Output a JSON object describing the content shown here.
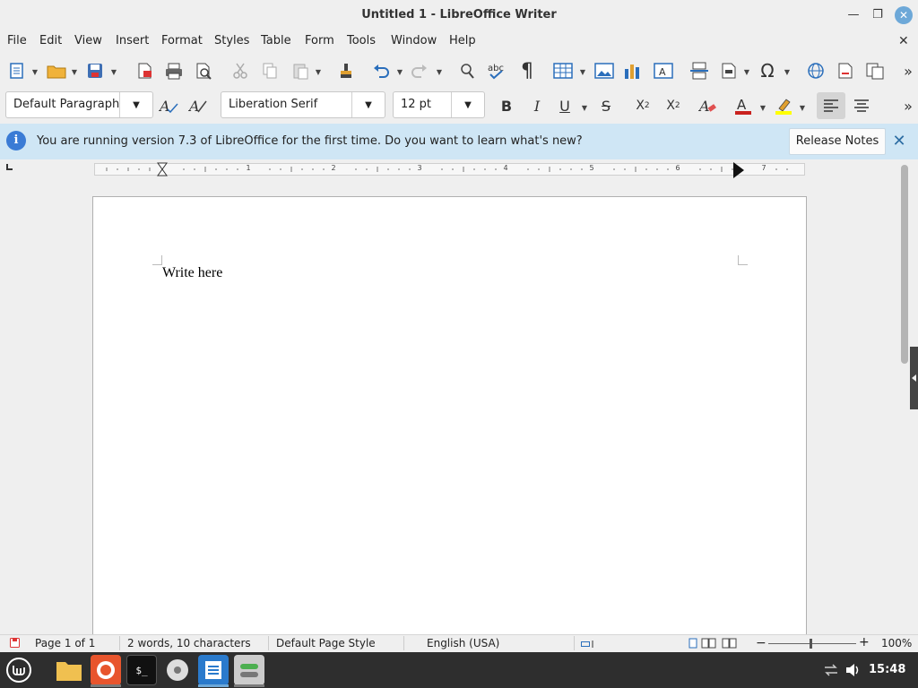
{
  "window": {
    "title": "Untitled 1 - LibreOffice Writer"
  },
  "menu": [
    "File",
    "Edit",
    "View",
    "Insert",
    "Format",
    "Styles",
    "Table",
    "Form",
    "Tools",
    "Window",
    "Help"
  ],
  "format_bar": {
    "paragraph_style": "Default Paragraph",
    "font_name": "Liberation Serif",
    "font_size": "12 pt"
  },
  "infobar": {
    "message": "You are running version 7.3 of LibreOffice for the first time. Do you want to learn what's new?",
    "button_label": "Release Notes"
  },
  "ruler": {
    "numbers": [
      "1",
      "2",
      "3",
      "4",
      "5",
      "6",
      "7"
    ]
  },
  "document": {
    "text": "Write here"
  },
  "status": {
    "page": "Page 1 of 1",
    "words": "2 words, 10 characters",
    "page_style": "Default Page Style",
    "language": "English (USA)",
    "zoom": "100%"
  },
  "taskbar": {
    "clock": "15:48"
  },
  "colors": {
    "accent": "#6da8d8",
    "infobar": "#cfe6f5",
    "font_color_bar": "#c9211e",
    "highlight_bar": "#ffff00"
  }
}
